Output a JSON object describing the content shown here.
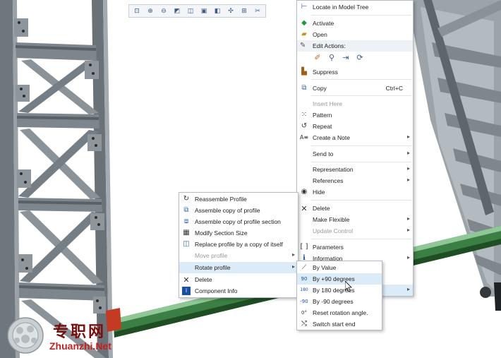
{
  "toolbar": {
    "buttons": [
      "zoom-fit-icon",
      "zoom-in-icon",
      "zoom-out-icon",
      "repaint-icon",
      "orient-icon",
      "saved-views-icon",
      "display-style-icon",
      "datum-display-icon",
      "annotation-display-icon",
      "spin-center-icon"
    ],
    "glyphs": [
      "⊡",
      "⊕",
      "⊖",
      "◩",
      "◫",
      "▣",
      "◧",
      "✣",
      "⊞",
      "✂"
    ]
  },
  "main_menu": {
    "items": {
      "locate": "Locate in Model Tree",
      "activate": "Activate",
      "open": "Open",
      "edit_actions": "Edit Actions:",
      "suppress": "Suppress",
      "copy": "Copy",
      "copy_shortcut": "Ctrl+C",
      "insert_here": "Insert Here",
      "pattern": "Pattern",
      "repeat": "Repeat",
      "create_note": "Create a Note",
      "send_to": "Send to",
      "representation": "Representation",
      "references": "References",
      "hide": "Hide",
      "delete": "Delete",
      "make_flexible": "Make Flexible",
      "update_control": "Update Control",
      "parameters": "Parameters",
      "information": "Information"
    }
  },
  "profile_menu": {
    "items": {
      "reassemble": "Reassemble Profile",
      "assemble_copy": "Assemble copy of profile",
      "assemble_copy_section": "Assemble copy of profile section",
      "modify_section": "Modify Section Size",
      "replace_profile": "Replace profile by a copy of itself",
      "move_profile": "Move profile",
      "rotate_profile": "Rotate profile",
      "delete": "Delete",
      "component_info": "Component Info"
    }
  },
  "rotate_menu": {
    "items": {
      "by_value": "By Value",
      "by_plus_90": "By +90 degrees",
      "by_180": "By 180 degrees",
      "by_minus_90": "By -90 degrees",
      "reset": "Reset rotation angle.",
      "switch_end": "Switch start end"
    }
  },
  "watermark": {
    "chinese": "专职网",
    "latin": "Zhuanzhi.Net"
  },
  "colors": {
    "steel": "#7d858c",
    "steel_dark": "#4f565c",
    "beam_green": "#2f6b36",
    "highlight": "#dcebf8"
  }
}
